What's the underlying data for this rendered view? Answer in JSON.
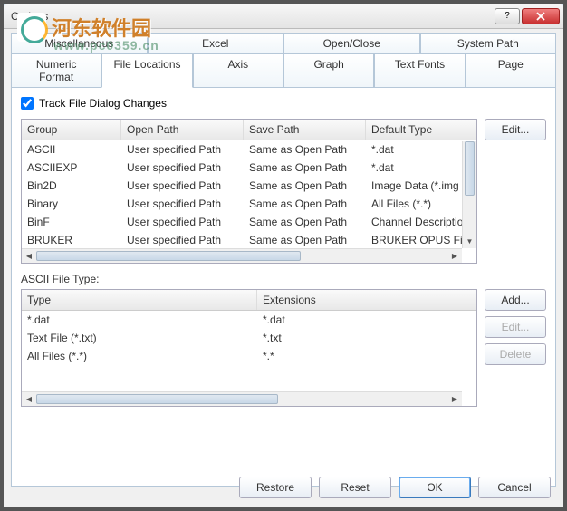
{
  "window": {
    "title": "Options"
  },
  "watermark": {
    "text": "河东软件园",
    "url": "www.pc0359.cn"
  },
  "tabs_row1": [
    "Miscellaneous",
    "Excel",
    "Open/Close",
    "System Path"
  ],
  "tabs_row2": [
    "Numeric Format",
    "File Locations",
    "Axis",
    "Graph",
    "Text Fonts",
    "Page"
  ],
  "active_tab": "File Locations",
  "checkbox": {
    "label": "Track File Dialog Changes",
    "checked": true
  },
  "grid1": {
    "headers": [
      "Group",
      "Open Path",
      "Save Path",
      "Default Type"
    ],
    "rows": [
      [
        "ASCII",
        "User specified Path",
        "Same as Open Path",
        "*.dat"
      ],
      [
        "ASCIIEXP",
        "User specified Path",
        "Same as Open Path",
        "*.dat"
      ],
      [
        "Bin2D",
        "User specified Path",
        "Same as Open Path",
        "Image Data (*.img"
      ],
      [
        "Binary",
        "User specified Path",
        "Same as Open Path",
        "All Files (*.*)"
      ],
      [
        "BinF",
        "User specified Path",
        "Same as Open Path",
        "Channel Descriptio"
      ],
      [
        "BRUKER",
        "User specified Path",
        "Same as Open Path",
        "BRUKER OPUS File"
      ]
    ]
  },
  "side_buttons1": {
    "edit": "Edit..."
  },
  "section_label": "ASCII File Type:",
  "grid2": {
    "headers": [
      "Type",
      "Extensions"
    ],
    "rows": [
      [
        "*.dat",
        "*.dat"
      ],
      [
        "Text File (*.txt)",
        "*.txt"
      ],
      [
        "All Files (*.*)",
        "*.*"
      ]
    ]
  },
  "side_buttons2": {
    "add": "Add...",
    "edit": "Edit...",
    "delete": "Delete"
  },
  "bottom": {
    "restore": "Restore",
    "reset": "Reset",
    "ok": "OK",
    "cancel": "Cancel"
  }
}
